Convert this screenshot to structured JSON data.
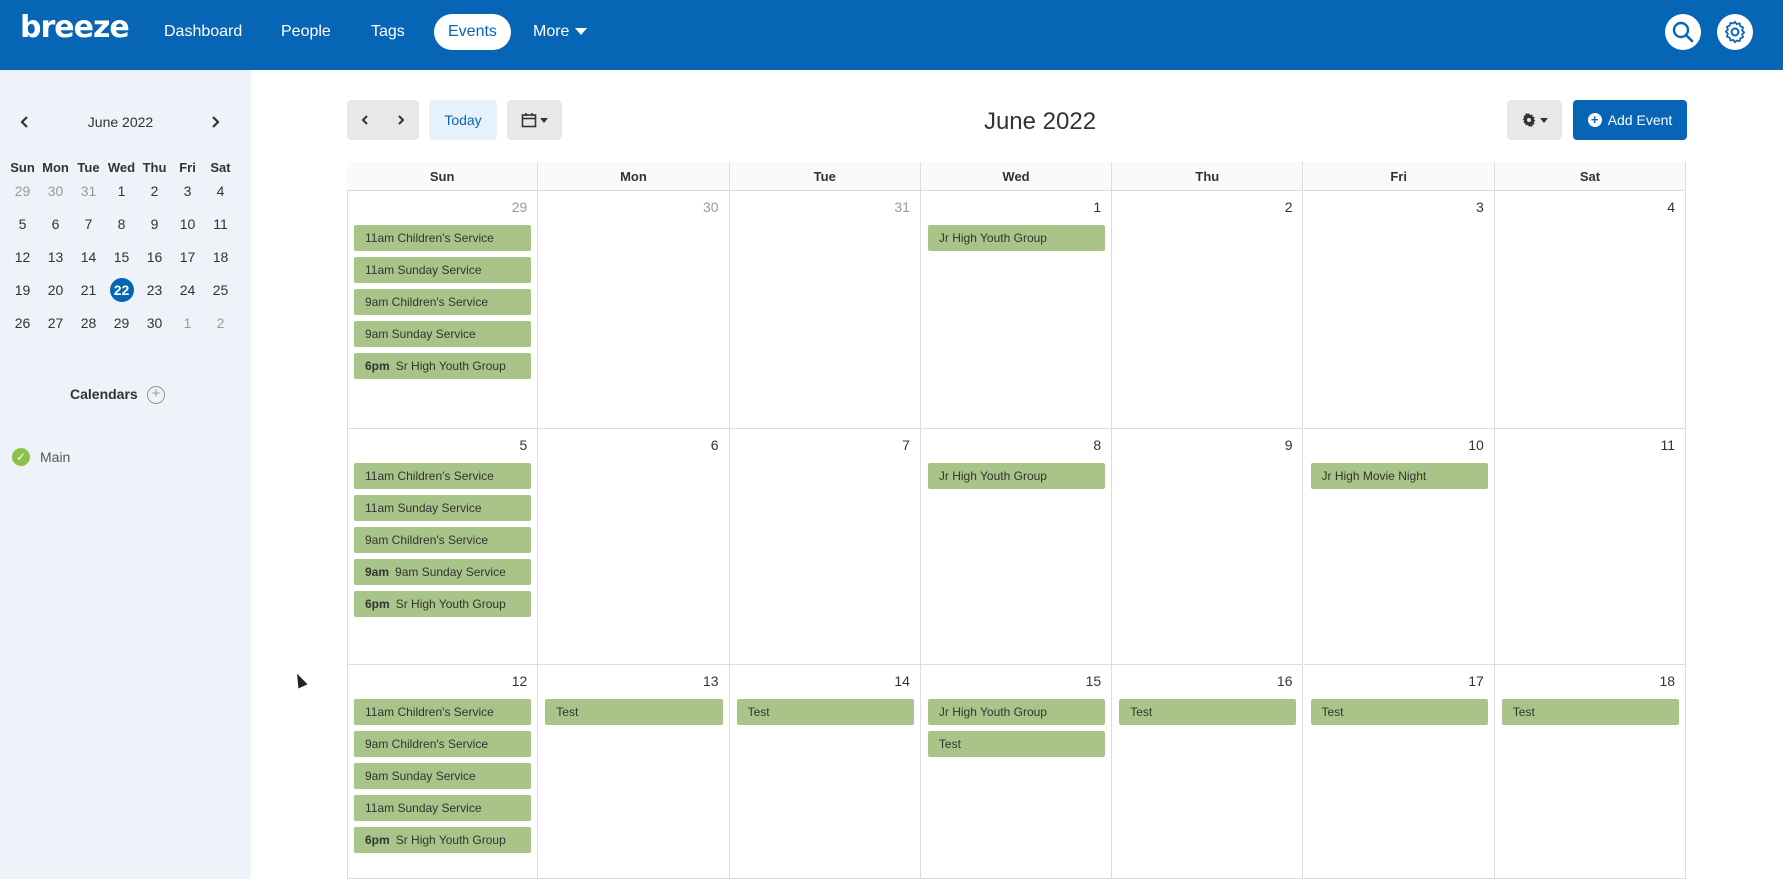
{
  "app": {
    "logo": "breeze"
  },
  "nav": [
    {
      "label": "Dashboard",
      "active": false
    },
    {
      "label": "People",
      "active": false
    },
    {
      "label": "Tags",
      "active": false
    },
    {
      "label": "Events",
      "active": true
    },
    {
      "label": "More",
      "active": false
    }
  ],
  "icons": {
    "search": "search-icon",
    "settings": "gear-icon"
  },
  "sidebar": {
    "month_label": "June 2022",
    "dow": [
      "Sun",
      "Mon",
      "Tue",
      "Wed",
      "Thu",
      "Fri",
      "Sat"
    ],
    "weeks": [
      [
        "29",
        "30",
        "31",
        "1",
        "2",
        "3",
        "4"
      ],
      [
        "5",
        "6",
        "7",
        "8",
        "9",
        "10",
        "11"
      ],
      [
        "12",
        "13",
        "14",
        "15",
        "16",
        "17",
        "18"
      ],
      [
        "19",
        "20",
        "21",
        "22",
        "23",
        "24",
        "25"
      ],
      [
        "26",
        "27",
        "28",
        "29",
        "30",
        "1",
        "2"
      ]
    ],
    "today": "22",
    "calendars_label": "Calendars",
    "calendars": [
      {
        "label": "Main"
      }
    ]
  },
  "toolbar": {
    "today_label": "Today",
    "title": "June 2022",
    "add_event_label": "Add Event"
  },
  "calendar": {
    "dow": [
      "Sun",
      "Mon",
      "Tue",
      "Wed",
      "Thu",
      "Fri",
      "Sat"
    ],
    "weeks": [
      {
        "days": [
          {
            "num": "29",
            "other": true,
            "events": [
              {
                "time": "",
                "title": "11am Children's Service"
              },
              {
                "time": "",
                "title": "11am Sunday Service"
              },
              {
                "time": "",
                "title": "9am Children's Service"
              },
              {
                "time": "",
                "title": "9am Sunday Service"
              },
              {
                "time": "6pm",
                "title": "Sr High Youth Group"
              }
            ]
          },
          {
            "num": "30",
            "other": true,
            "events": []
          },
          {
            "num": "31",
            "other": true,
            "events": []
          },
          {
            "num": "1",
            "other": false,
            "events": [
              {
                "time": "",
                "title": "Jr High Youth Group"
              }
            ]
          },
          {
            "num": "2",
            "other": false,
            "events": []
          },
          {
            "num": "3",
            "other": false,
            "events": []
          },
          {
            "num": "4",
            "other": false,
            "events": []
          }
        ]
      },
      {
        "days": [
          {
            "num": "5",
            "other": false,
            "events": [
              {
                "time": "",
                "title": "11am Children's Service"
              },
              {
                "time": "",
                "title": "11am Sunday Service"
              },
              {
                "time": "",
                "title": "9am Children's Service"
              },
              {
                "time": "9am",
                "title": "9am Sunday Service"
              },
              {
                "time": "6pm",
                "title": "Sr High Youth Group"
              }
            ]
          },
          {
            "num": "6",
            "other": false,
            "events": []
          },
          {
            "num": "7",
            "other": false,
            "events": []
          },
          {
            "num": "8",
            "other": false,
            "events": [
              {
                "time": "",
                "title": "Jr High Youth Group"
              }
            ]
          },
          {
            "num": "9",
            "other": false,
            "events": []
          },
          {
            "num": "10",
            "other": false,
            "events": [
              {
                "time": "",
                "title": "Jr High Movie Night"
              }
            ]
          },
          {
            "num": "11",
            "other": false,
            "events": []
          }
        ]
      },
      {
        "days": [
          {
            "num": "12",
            "other": false,
            "events": [
              {
                "time": "",
                "title": "11am Children's Service"
              },
              {
                "time": "",
                "title": "9am Children's Service"
              },
              {
                "time": "",
                "title": "9am Sunday Service"
              },
              {
                "time": "",
                "title": "11am Sunday Service"
              },
              {
                "time": "6pm",
                "title": "Sr High Youth Group"
              }
            ]
          },
          {
            "num": "13",
            "other": false,
            "events": [
              {
                "time": "",
                "title": "Test"
              }
            ]
          },
          {
            "num": "14",
            "other": false,
            "events": [
              {
                "time": "",
                "title": "Test"
              }
            ]
          },
          {
            "num": "15",
            "other": false,
            "events": [
              {
                "time": "",
                "title": "Jr High Youth Group"
              },
              {
                "time": "",
                "title": "Test"
              }
            ]
          },
          {
            "num": "16",
            "other": false,
            "events": [
              {
                "time": "",
                "title": "Test"
              }
            ]
          },
          {
            "num": "17",
            "other": false,
            "events": [
              {
                "time": "",
                "title": "Test"
              }
            ]
          },
          {
            "num": "18",
            "other": false,
            "events": [
              {
                "time": "",
                "title": "Test"
              }
            ]
          }
        ]
      }
    ]
  },
  "colors": {
    "brand": "#0765b5",
    "event": "#a9c488",
    "sidebar": "#eef3f9"
  }
}
